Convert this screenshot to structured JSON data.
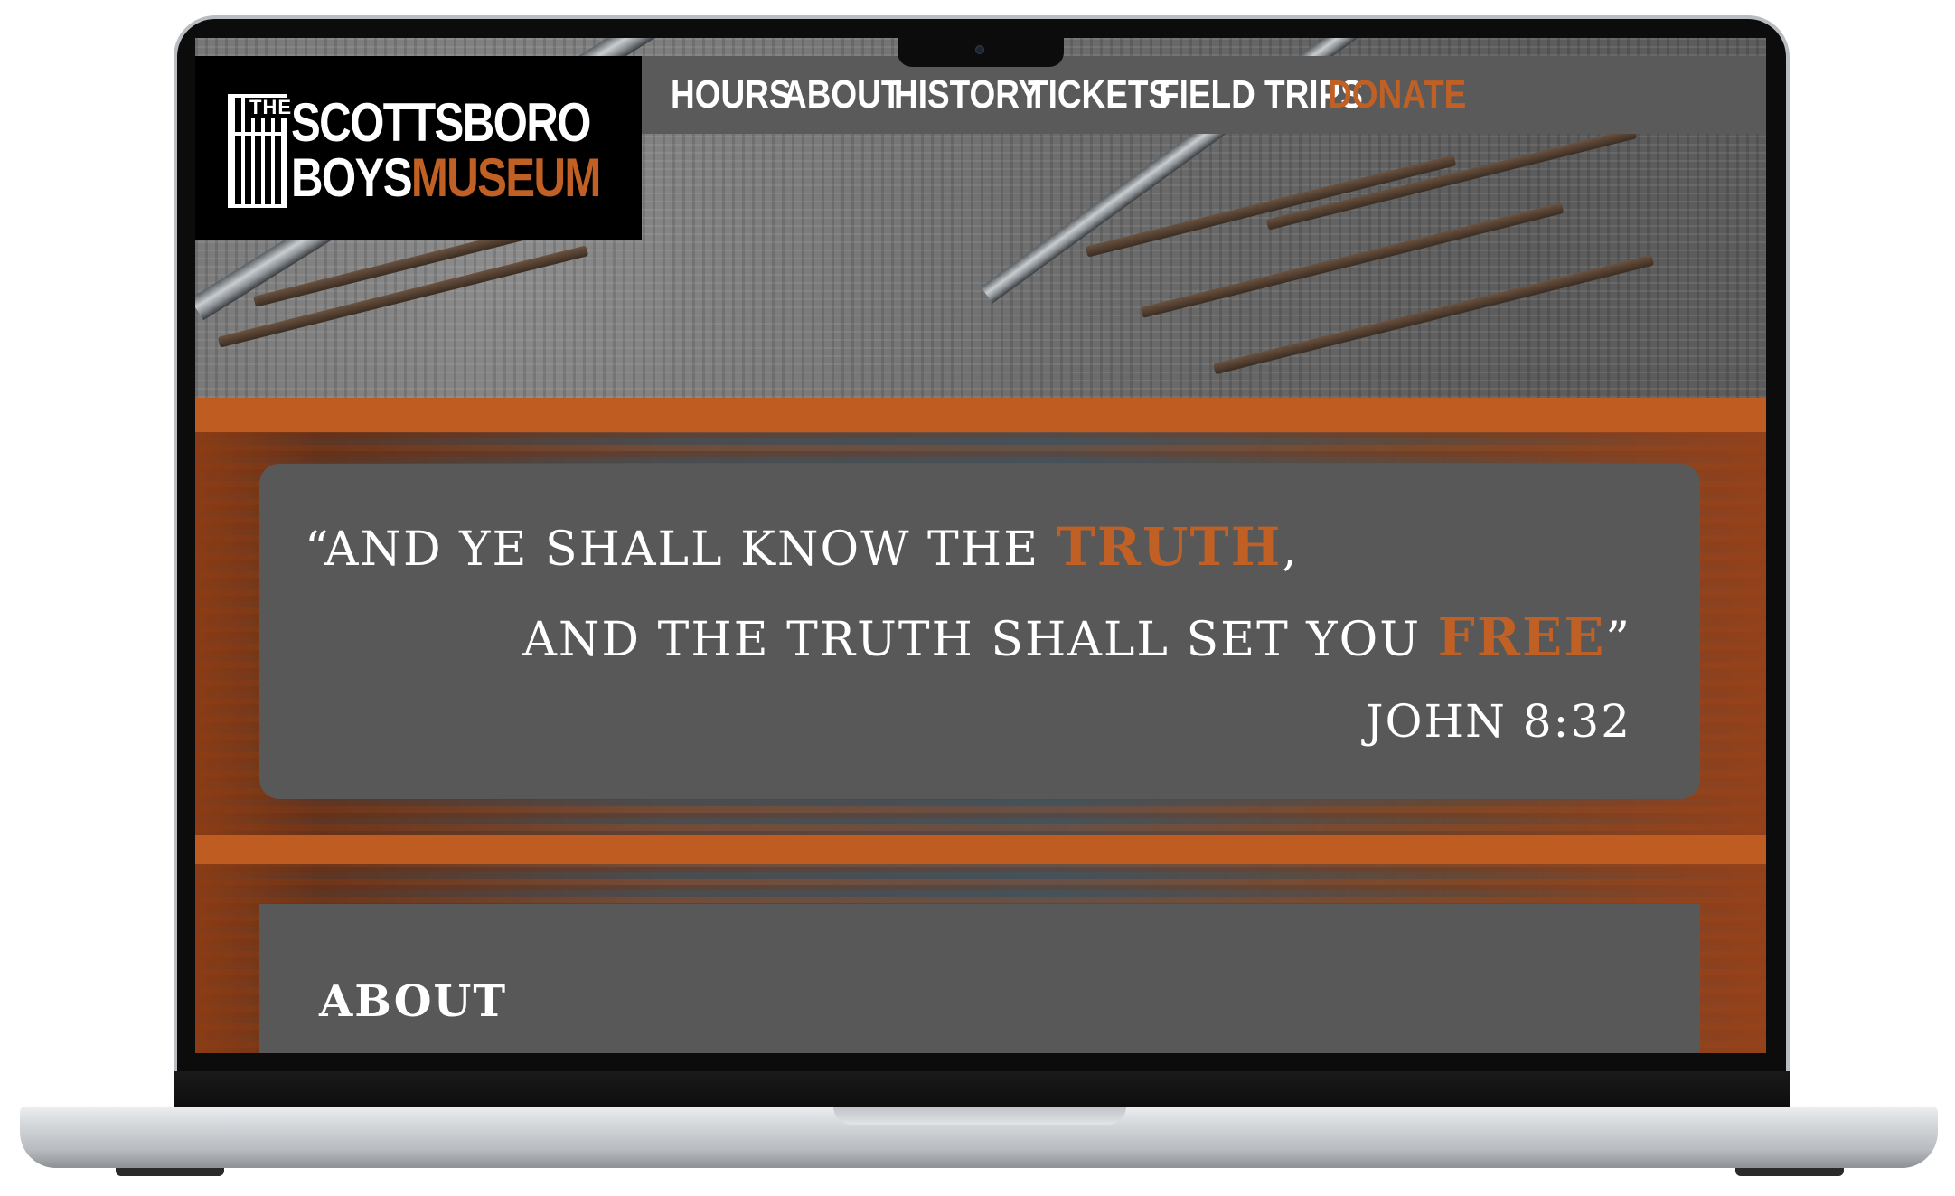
{
  "logo": {
    "the": "THE",
    "line1": "SCOTTSBORO",
    "line2_a": "BOYS",
    "line2_b": "MUSEUM"
  },
  "nav": {
    "items": [
      "HOURS",
      "ABOUT",
      "HISTORY",
      "TICKETS",
      "FIELD TRIPS",
      "DONATE"
    ]
  },
  "quote": {
    "open_mark": "“",
    "line1_text": "AND YE SHALL KNOW THE ",
    "line1_accent": "TRUTH",
    "line1_end": ",",
    "line2_text": "AND THE TRUTH SHALL SET YOU ",
    "line2_accent": "FREE",
    "close_mark": "”",
    "citation": "JOHN 8:32"
  },
  "about": {
    "title": "ABOUT"
  },
  "colors": {
    "accent": "#c06025",
    "card": "#585858",
    "nav_bg": "#5a5a5a"
  },
  "icons": [
    "jail-cell-icon",
    "camera-icon"
  ]
}
